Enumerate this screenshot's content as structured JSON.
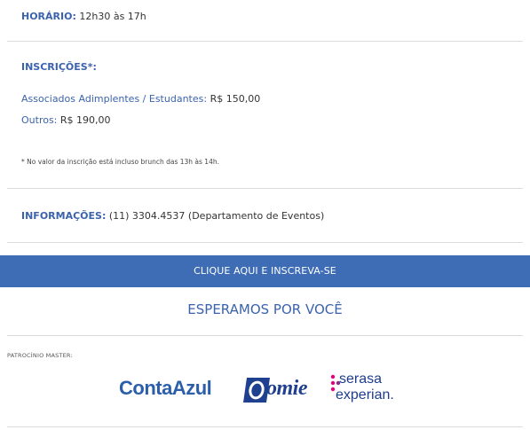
{
  "horario": {
    "label": "HORÁRIO:",
    "value": "12h30 às 17h"
  },
  "inscricoes": {
    "title": "INSCRIÇÕES*:",
    "associados_label": "Associados Adimplentes / Estudantes:",
    "associados_value": "R$ 150,00",
    "outros_label": "Outros:",
    "outros_value": "R$ 190,00",
    "note": "* No valor da inscrição está incluso brunch das 13h às 14h."
  },
  "informacoes": {
    "label": "INFORMAÇÕES:",
    "value": "(11) 3304.4537 (Departamento de Eventos)"
  },
  "cta_label": "CLIQUE AQUI E INSCREVA-SE",
  "esperamos": "ESPERAMOS POR VOCÊ",
  "patrocinio_label": "PATROCÍNIO MASTER:",
  "sponsors": {
    "contaazul": "ContaAzul",
    "omie": "omie",
    "serasa_top": "serasa",
    "serasa_bottom": "experian."
  },
  "colors": {
    "brand_blue": "#3b63ad",
    "cta_bg": "#3e6cb5",
    "serasa_pink": "#e4007c"
  }
}
